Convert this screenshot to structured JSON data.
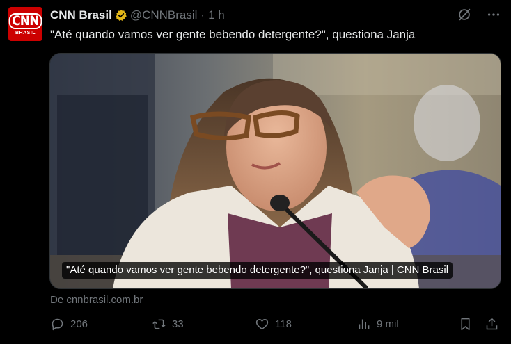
{
  "author": {
    "avatar_logo": "CNN",
    "avatar_sub": "BRASIL",
    "name": "CNN Brasil",
    "handle": "@CNNBrasil",
    "separator": "·",
    "time": "1 h"
  },
  "tweet": {
    "text": "\"Até quando vamos ver gente bebendo detergente?\", questiona Janja"
  },
  "card": {
    "caption": "\"Até quando vamos ver gente bebendo detergente?\", questiona Janja | CNN Brasil",
    "source": "De cnnbrasil.com.br"
  },
  "actions": {
    "replies": "206",
    "reposts": "33",
    "likes": "118",
    "views": "9 mil"
  },
  "icons": {
    "top": [
      "grok-icon",
      "more-icon"
    ],
    "bottom": [
      "reply-icon",
      "repost-icon",
      "like-icon",
      "views-icon",
      "bookmark-icon",
      "share-icon"
    ]
  },
  "colors": {
    "background": "#000000",
    "text": "#e7e9ea",
    "muted": "#71767b",
    "brand_red": "#cc0000",
    "verified_gold": "#e2b719"
  }
}
